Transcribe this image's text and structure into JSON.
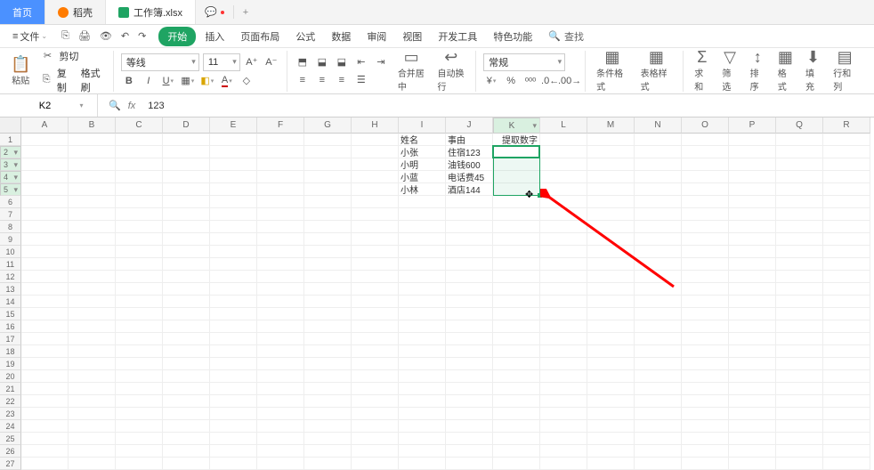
{
  "tabs": {
    "home": "首页",
    "docker": "稻壳",
    "file": "工作簿.xlsx",
    "add": "+"
  },
  "menubar": {
    "file": "文件",
    "items": [
      "开始",
      "插入",
      "页面布局",
      "公式",
      "数据",
      "审阅",
      "视图",
      "开发工具",
      "特色功能"
    ],
    "search_icon": "🔍",
    "search": "查找"
  },
  "qa": {
    "i1": "⎘",
    "i2": "🖨",
    "i3": "👁",
    "i4": "↶",
    "i5": "↷"
  },
  "ribbon": {
    "paste": "粘贴",
    "cut": "剪切",
    "copy": "复制",
    "format_painter": "格式刷",
    "font": "等线",
    "size": "11",
    "merge": "合并居中",
    "wrap": "自动换行",
    "numfmt": "常规",
    "cond": "条件格式",
    "tablestyle": "表格样式",
    "sum": "求和",
    "filter": "筛选",
    "sort": "排序",
    "format": "格式",
    "fill": "填充",
    "rowcol": "行和列"
  },
  "formula": {
    "cell": "K2",
    "fx": "fx",
    "value": "123"
  },
  "columns": [
    "A",
    "B",
    "C",
    "D",
    "E",
    "F",
    "G",
    "H",
    "I",
    "J",
    "K",
    "L",
    "M",
    "N",
    "O",
    "P",
    "Q",
    "R"
  ],
  "rows_count": 27,
  "sheet": {
    "I1": "姓名",
    "J1": "事由",
    "K1": "提取数字",
    "I2": "小张",
    "J2": "住宿123",
    "K2": "123",
    "I3": "小明",
    "J3": "油钱600",
    "I4": "小蓝",
    "J4": "电话费45",
    "I5": "小林",
    "J5": "酒店144"
  },
  "selected_col": "K",
  "selected_rows": [
    2,
    3,
    4,
    5
  ],
  "active": "K2"
}
